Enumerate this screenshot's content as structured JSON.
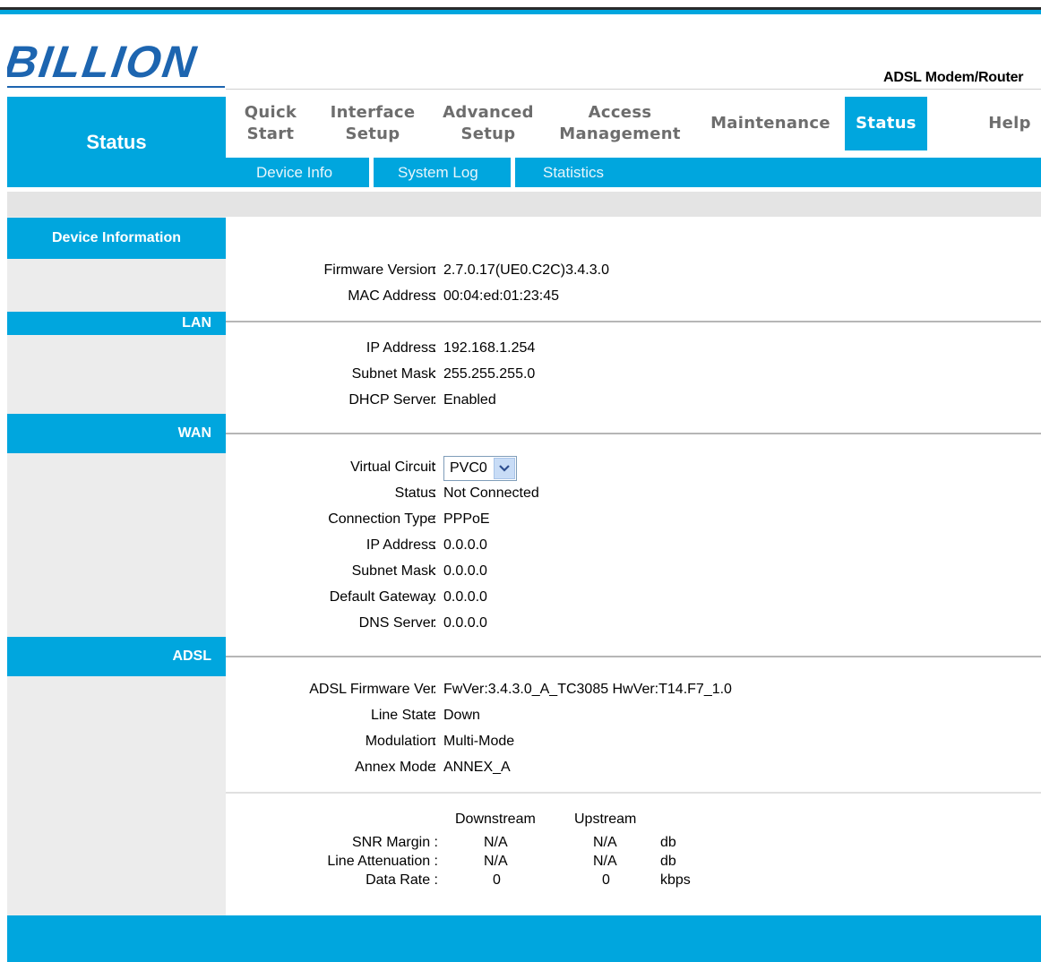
{
  "brand": {
    "logo_text": "BILLION",
    "product": "ADSL Modem/Router"
  },
  "page_title": "Status",
  "nav": [
    {
      "line1": "Quick",
      "line2": "Start"
    },
    {
      "line1": "Interface",
      "line2": "Setup"
    },
    {
      "line1": "Advanced",
      "line2": "Setup"
    },
    {
      "line1": "Access",
      "line2": "Management"
    },
    {
      "line1": "Maintenance",
      "line2": ""
    },
    {
      "line1": "Status",
      "line2": ""
    },
    {
      "line1": "Help",
      "line2": ""
    }
  ],
  "active_nav": "Status",
  "subnav": [
    "Device Info",
    "System Log",
    "Statistics"
  ],
  "sections": {
    "device_info": {
      "header": "Device Information",
      "rows": [
        {
          "label": "Firmware Version",
          "value": "2.7.0.17(UE0.C2C)3.4.3.0"
        },
        {
          "label": "MAC Address",
          "value": "00:04:ed:01:23:45"
        }
      ]
    },
    "lan": {
      "header": "LAN",
      "rows": [
        {
          "label": "IP Address",
          "value": "192.168.1.254"
        },
        {
          "label": "Subnet Mask",
          "value": "255.255.255.0"
        },
        {
          "label": "DHCP Server",
          "value": "Enabled"
        }
      ]
    },
    "wan": {
      "header": "WAN",
      "virtual_circuit": {
        "label": "Virtual Circuit",
        "selected": "PVC0"
      },
      "rows": [
        {
          "label": "Status",
          "value": "Not Connected"
        },
        {
          "label": "Connection Type",
          "value": "PPPoE"
        },
        {
          "label": "IP Address",
          "value": "0.0.0.0"
        },
        {
          "label": "Subnet Mask",
          "value": "0.0.0.0"
        },
        {
          "label": "Default Gateway",
          "value": "0.0.0.0"
        },
        {
          "label": "DNS Server",
          "value": "0.0.0.0"
        }
      ]
    },
    "adsl": {
      "header": "ADSL",
      "rows": [
        {
          "label": "ADSL Firmware Ver",
          "value": "FwVer:3.4.3.0_A_TC3085 HwVer:T14.F7_1.0"
        },
        {
          "label": "Line State",
          "value": "Down"
        },
        {
          "label": "Modulation",
          "value": "Multi-Mode"
        },
        {
          "label": "Annex Mode",
          "value": "ANNEX_A"
        }
      ],
      "table": {
        "headers": [
          "Downstream",
          "Upstream"
        ],
        "rows": [
          {
            "label": "SNR Margin :",
            "down": "N/A",
            "up": "N/A",
            "unit": "db"
          },
          {
            "label": "Line Attenuation :",
            "down": "N/A",
            "up": "N/A",
            "unit": "db"
          },
          {
            "label": "Data Rate :",
            "down": "0",
            "up": "0",
            "unit": "kbps"
          }
        ]
      }
    }
  },
  "colors": {
    "accent": "#00a6de",
    "sidebar": "#ececec",
    "nav_text": "#6d6d6d"
  },
  "icons": [
    "chevron-down-icon"
  ]
}
